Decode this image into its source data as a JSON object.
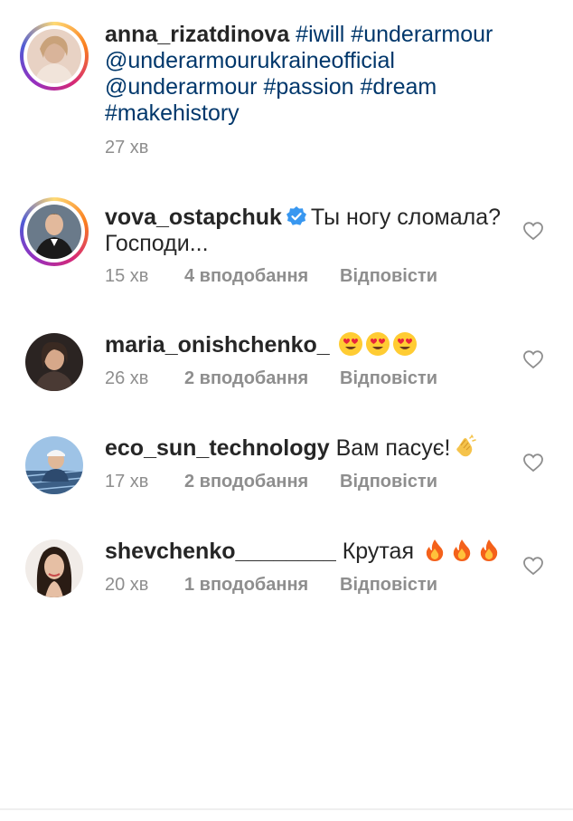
{
  "caption": {
    "username": "anna_rizatdinova",
    "line1_tags": " #iwill #underarmour",
    "line2": "@underarmourukraineofficial",
    "line3": "@underarmour #passion #dream",
    "line4": "#makehistory",
    "time": "27 хв"
  },
  "comments": [
    {
      "username": "vova_ostapchuk",
      "verified": true,
      "text_line1": "Ты ногу сломала?",
      "text_line2": "Господи...",
      "time": "15 хв",
      "likes": "4 вподобання",
      "reply": "Відповісти"
    },
    {
      "username": "maria_onishchenko_",
      "text": "",
      "emoji": [
        "heart-eyes-emoji",
        "heart-eyes-emoji",
        "heart-eyes-emoji"
      ],
      "time": "26 хв",
      "likes": "2 вподобання",
      "reply": "Відповісти"
    },
    {
      "username": "eco_sun_technology",
      "text": "Вам пасує!",
      "emoji": [
        "clapping-hands-emoji"
      ],
      "time": "17 хв",
      "likes": "2 вподобання",
      "reply": "Відповісти"
    },
    {
      "username": "shevchenko________",
      "text": "Крутая",
      "emoji": [
        "fire-emoji",
        "fire-emoji",
        "fire-emoji"
      ],
      "time": "20 хв",
      "likes": "1 вподобання",
      "reply": "Відповісти"
    }
  ],
  "colors": {
    "username": "#262626",
    "hashtag": "#00376b",
    "meta": "#8e8e8e",
    "verified": "#3897f0"
  }
}
